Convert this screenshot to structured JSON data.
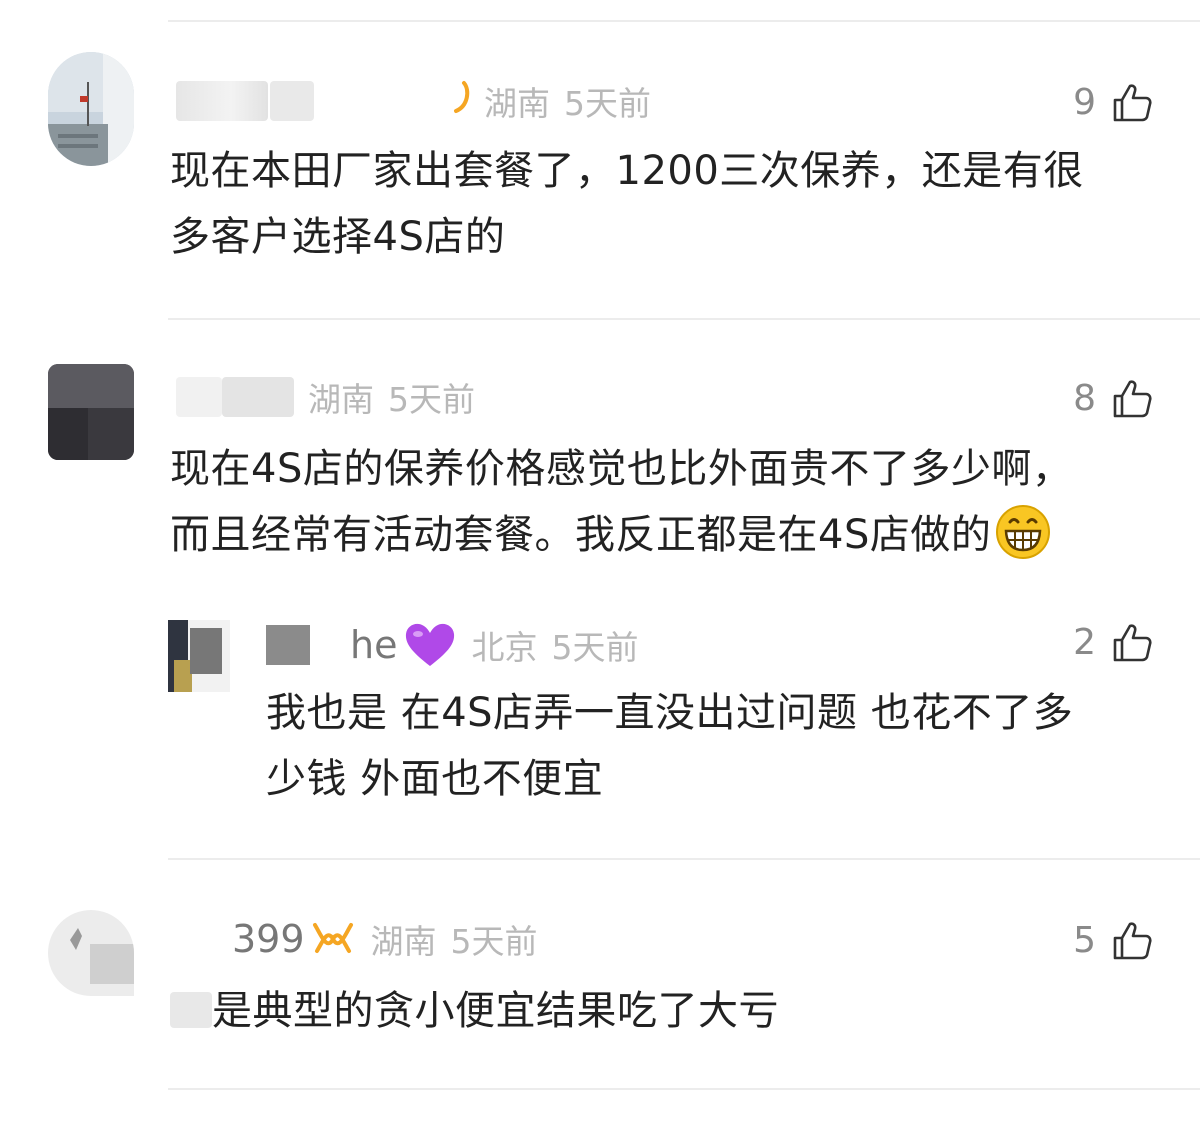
{
  "comments": [
    {
      "name_fragment": "",
      "location": "湖南",
      "time": "5天前",
      "likes": "9",
      "text_lines": [
        "现在本田厂家出套餐了，1200三次保养，还是有很",
        "多客户选择4S店的"
      ]
    },
    {
      "name_fragment": "",
      "location": "湖南",
      "time": "5天前",
      "likes": "8",
      "text_lines": [
        "现在4S店的保养价格感觉也比外面贵不了多少啊，",
        "而且经常有活动套餐。我反正都是在4S店做的"
      ]
    },
    {
      "name_fragment": "he",
      "location": "北京",
      "time": "5天前",
      "likes": "2",
      "text_lines": [
        "我也是 在4S店弄一直没出过问题 也花不了多",
        "少钱 外面也不便宜"
      ]
    },
    {
      "name_fragment": "399",
      "location": "湖南",
      "time": "5天前",
      "likes": "5",
      "text_lines": [
        "是典型的贪小便宜结果吃了大亏"
      ]
    }
  ],
  "colors": {
    "meta_text": "#b8b8b8",
    "body_text": "#222222",
    "badge_orange": "#f5a623",
    "heart_purple": "#b049e8",
    "divider": "#ececec"
  },
  "icons": {
    "like": "thumbs-up-icon",
    "badge": "vip-badge-icon",
    "heart": "purple-heart-icon",
    "emoji": "grinning-face-icon"
  }
}
